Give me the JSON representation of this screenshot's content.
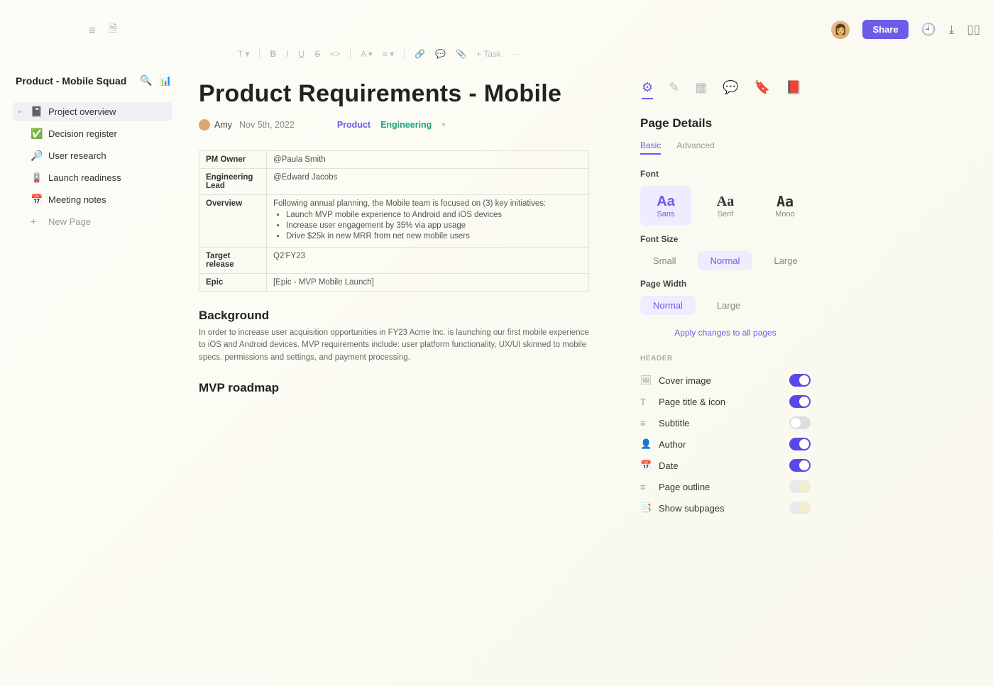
{
  "header": {
    "share_label": "Share"
  },
  "sidebar": {
    "workspace": "Product - Mobile Squad",
    "items": [
      {
        "icon": "📓",
        "label": "Project overview",
        "active": true
      },
      {
        "icon": "✅",
        "label": "Decision register"
      },
      {
        "icon": "🔎",
        "label": "User research"
      },
      {
        "icon": "🪫",
        "label": "Launch readiness"
      },
      {
        "icon": "📅",
        "label": "Meeting notes"
      }
    ],
    "new_page": "New Page"
  },
  "toolbar": {
    "task_label": "+ Task",
    "more": "···"
  },
  "doc": {
    "title": "Product Requirements - Mobile",
    "author": "Amy",
    "date": "Nov 5th, 2022",
    "tag1": "Product",
    "tag2": "Engineering",
    "rows": {
      "pm_owner_k": "PM Owner",
      "pm_owner_v": "@Paula Smith",
      "eng_lead_k": "Engineering Lead",
      "eng_lead_v": "@Edward Jacobs",
      "overview_k": "Overview",
      "overview_intro": "Following annual planning, the Mobile team is focused on (3) key initiatives:",
      "overview_b1": "Launch MVP mobile experience to Android and iOS devices",
      "overview_b2": "Increase user engagement by 35% via app usage",
      "overview_b3": "Drive $25k in new MRR from net new mobile users",
      "target_k": "Target release",
      "target_v": "Q2'FY23",
      "epic_k": "Epic",
      "epic_v": "[Epic - MVP Mobile Launch]"
    },
    "bg_h": "Background",
    "bg_p": "In order to increase user acquisition opportunities in FY23 Acme Inc. is launching our first mobile experience to iOS and Android devices. MVP requirements include: user platform functionality, UX/UI skinned to mobile specs, permissions and settings, and payment processing.",
    "mvp_h": "MVP roadmap"
  },
  "rpanel": {
    "title": "Page Details",
    "subtabs": {
      "basic": "Basic",
      "advanced": "Advanced"
    },
    "font_label": "Font",
    "fonts": {
      "sans": "Sans",
      "serif": "Serif",
      "mono": "Mono"
    },
    "font_size_label": "Font Size",
    "sizes": {
      "small": "Small",
      "normal": "Normal",
      "large": "Large"
    },
    "width_label": "Page Width",
    "widths": {
      "normal": "Normal",
      "large": "Large"
    },
    "apply": "Apply changes to all pages",
    "header_section": "HEADER",
    "toggles": [
      {
        "icon": "🖼",
        "label": "Cover image",
        "state": "on"
      },
      {
        "icon": "T",
        "label": "Page title & icon",
        "state": "on"
      },
      {
        "icon": "≡",
        "label": "Subtitle",
        "state": "off"
      },
      {
        "icon": "👤",
        "label": "Author",
        "state": "on"
      },
      {
        "icon": "📅",
        "label": "Date",
        "state": "on"
      },
      {
        "icon": "≡",
        "label": "Page outline",
        "state": "mid"
      },
      {
        "icon": "📑",
        "label": "Show subpages",
        "state": "mid"
      }
    ]
  }
}
